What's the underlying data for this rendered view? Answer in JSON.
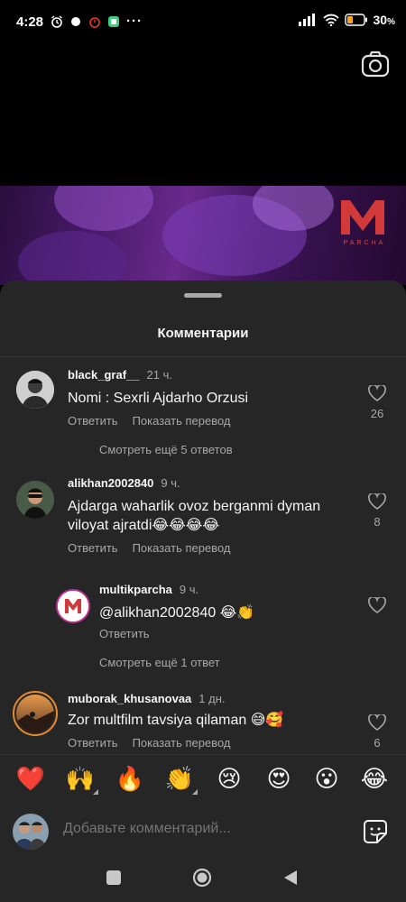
{
  "status_bar": {
    "time": "4:28",
    "battery": "30"
  },
  "video": {
    "logo_letter": "M",
    "logo_caption": "PARCHA"
  },
  "sheet": {
    "title": "Комментарии"
  },
  "comments": [
    {
      "username": "black_graf__",
      "time": "21 ч.",
      "text": "Nomi : Sexrli Ajdarho Orzusi",
      "reply_label": "Ответить",
      "translate_label": "Показать перевод",
      "likes": "26",
      "more_replies": "Смотреть ещё 5 ответов"
    },
    {
      "username": "alikhan2002840",
      "time": "9 ч.",
      "text": "Ajdarga waharlik ovoz berganmi dyman viloyat ajratdi😂😂😂😂",
      "reply_label": "Ответить",
      "translate_label": "Показать перевод",
      "likes": "8"
    },
    {
      "username": "multikparcha",
      "time": "9 ч.",
      "text": "@alikhan2002840 😂👏",
      "reply_label": "Ответить",
      "more_replies": "Смотреть ещё 1 ответ"
    },
    {
      "username": "muborak_khusanovaa",
      "time": "1 дн.",
      "text": "Zor multfilm tavsiya qilaman 😅🥰",
      "reply_label": "Ответить",
      "translate_label": "Показать перевод",
      "likes": "6"
    }
  ],
  "emoji_bar": [
    "❤️",
    "🙌",
    "🔥",
    "👏",
    "😢",
    "😍",
    "😮",
    "😂"
  ],
  "composer": {
    "placeholder": "Добавьте комментарий..."
  },
  "colors": {
    "sheet_bg": "#262626",
    "secondary_text": "#a8a8a8",
    "brand_red": "#d23a3a"
  }
}
